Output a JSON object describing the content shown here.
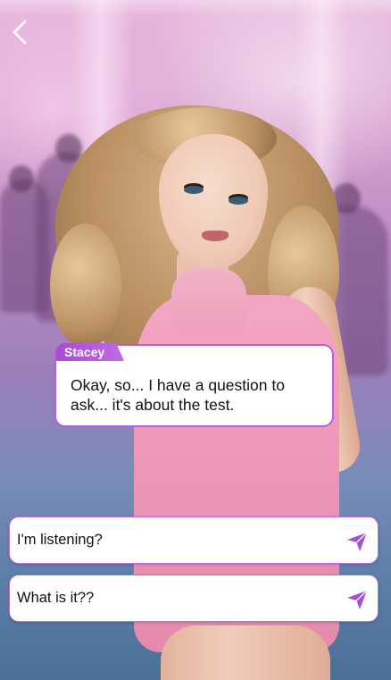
{
  "theme": {
    "accent": "#b65ee0",
    "tag_gradient_start": "#a84ad6",
    "tag_gradient_end": "#c06be6",
    "send_icon_color": "#a34fd8",
    "text_color": "#111111"
  },
  "nav": {
    "back_icon": "chevron-left-icon"
  },
  "dialogue": {
    "speaker": "Stacey",
    "text": "Okay, so... I have a question to ask... it's about the test."
  },
  "choices": [
    {
      "label": "I'm listening?",
      "icon": "send-icon"
    },
    {
      "label": "What is it??",
      "icon": "send-icon"
    }
  ]
}
